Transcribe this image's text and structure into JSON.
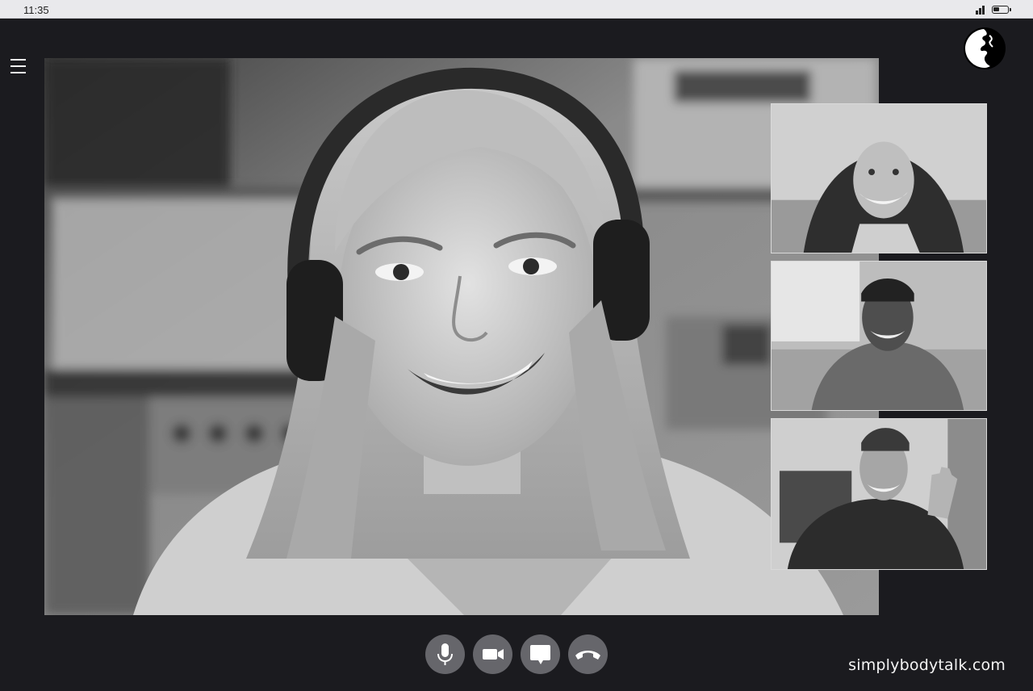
{
  "status_bar": {
    "time": "11:35",
    "icons": [
      "signal-icon",
      "battery-icon"
    ],
    "battery_level": 0.45
  },
  "header": {
    "menu_icon": "menu-icon",
    "logo_icon": "simply-body-talk-logo"
  },
  "call": {
    "main_participant": "speaker",
    "thumbnails": [
      "participant-1",
      "participant-2",
      "participant-3"
    ]
  },
  "controls": {
    "buttons": [
      {
        "name": "microphone",
        "icon": "microphone-icon"
      },
      {
        "name": "camera",
        "icon": "video-camera-icon"
      },
      {
        "name": "chat",
        "icon": "chat-bubble-icon"
      },
      {
        "name": "end-call",
        "icon": "hang-up-icon"
      }
    ]
  },
  "footer": {
    "credit": "simplybodytalk.com"
  },
  "colors": {
    "background": "#1b1b1f",
    "status_bar": "#e9e9ec",
    "control_button": "#66666b",
    "text_light": "#f4f4f4"
  }
}
